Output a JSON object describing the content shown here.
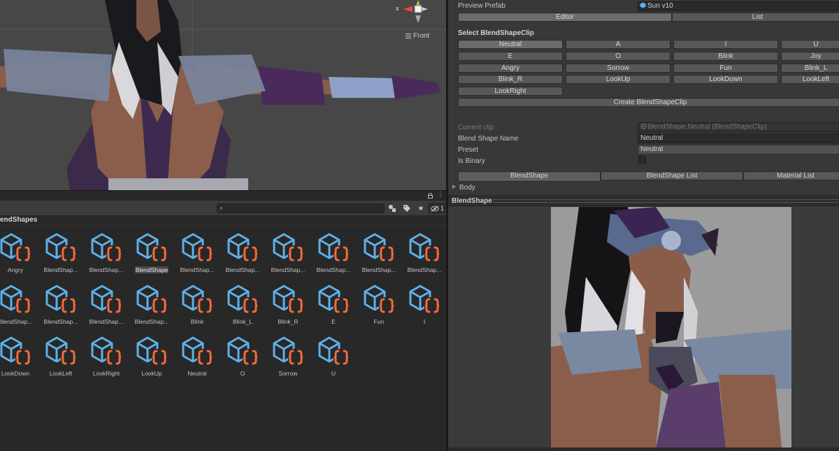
{
  "scene": {
    "view_label": "Front",
    "gizmo_axis_label": "x"
  },
  "project": {
    "search_placeholder": "",
    "hidden_count": "1",
    "breadcrumb": "BlendShapes",
    "assets": [
      {
        "label": "Angry",
        "selected": false
      },
      {
        "label": "BlendShap...",
        "selected": false
      },
      {
        "label": "BlendShap...",
        "selected": false
      },
      {
        "label": "BlendShape",
        "selected": true
      },
      {
        "label": "BlendShap...",
        "selected": false
      },
      {
        "label": "BlendShap...",
        "selected": false
      },
      {
        "label": "BlendShap...",
        "selected": false
      },
      {
        "label": "BlendShap...",
        "selected": false
      },
      {
        "label": "BlendShap...",
        "selected": false
      },
      {
        "label": "BlendShap...",
        "selected": false
      },
      {
        "label": "BlendShap...",
        "selected": false
      },
      {
        "label": "BlendShap...",
        "selected": false
      },
      {
        "label": "BlendShap...",
        "selected": false
      },
      {
        "label": "BlendShap...",
        "selected": false
      },
      {
        "label": "Blink",
        "selected": false
      },
      {
        "label": "Blink_L",
        "selected": false
      },
      {
        "label": "Blink_R",
        "selected": false
      },
      {
        "label": "E",
        "selected": false
      },
      {
        "label": "Fun",
        "selected": false
      },
      {
        "label": "I",
        "selected": false
      },
      {
        "label": "LookDown",
        "selected": false
      },
      {
        "label": "LookLeft",
        "selected": false
      },
      {
        "label": "LookRight",
        "selected": false
      },
      {
        "label": "LookUp",
        "selected": false
      },
      {
        "label": "Neutral",
        "selected": false
      },
      {
        "label": "O",
        "selected": false
      },
      {
        "label": "Sorrow",
        "selected": false
      },
      {
        "label": "U",
        "selected": false
      }
    ]
  },
  "inspector": {
    "preview_prefab_label": "Preview Prefab",
    "preview_prefab_value": "Sun v10",
    "mode_tabs": [
      "Editor",
      "List"
    ],
    "select_title": "Select BlendShapeClip",
    "clip_buttons": [
      [
        "Neutral",
        "A",
        "I",
        "U"
      ],
      [
        "E",
        "O",
        "Blink",
        "Joy"
      ],
      [
        "Angry",
        "Sorrow",
        "Fun",
        "Blink_L"
      ],
      [
        "Blink_R",
        "LookUp",
        "LookDown",
        "LookLeft"
      ],
      [
        "LookRight"
      ]
    ],
    "create_button": "Create BlendShapeClip",
    "current_clip_label": "Current clip",
    "current_clip_value": "BlendShape.Neutral (BlendShapeClip)",
    "blend_shape_name_label": "Blend Shape Name",
    "blend_shape_name_value": "Neutral",
    "preset_label": "Preset",
    "preset_value": "Neutral",
    "is_binary_label": "Is Binary",
    "sub_tabs": [
      "BlendShape",
      "BlendShape List",
      "Material List"
    ],
    "body_foldout": "Body"
  },
  "preview": {
    "title": "BlendShape"
  },
  "colors": {
    "cube_blue": "#5fb0e8",
    "brace_orange": "#f26a3a"
  }
}
